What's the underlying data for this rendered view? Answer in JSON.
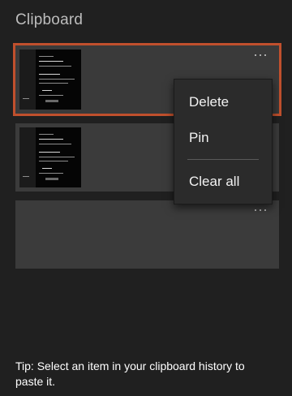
{
  "panel": {
    "title": "Clipboard"
  },
  "items": [
    {
      "kind": "image",
      "selected": true,
      "more_icon": "more-horizontal-icon"
    },
    {
      "kind": "image",
      "selected": false,
      "more_icon": "more-horizontal-icon"
    },
    {
      "kind": "empty",
      "selected": false,
      "more_icon": "more-horizontal-icon"
    }
  ],
  "context_menu": {
    "items": [
      "Delete",
      "Pin",
      "Clear all"
    ]
  },
  "tip": {
    "text": "Tip: Select an item in your clipboard history to paste it."
  },
  "colors": {
    "background": "#202020",
    "item_background": "#3b3b3b",
    "selection_border": "#c0502d",
    "menu_background": "#2b2b2b"
  }
}
